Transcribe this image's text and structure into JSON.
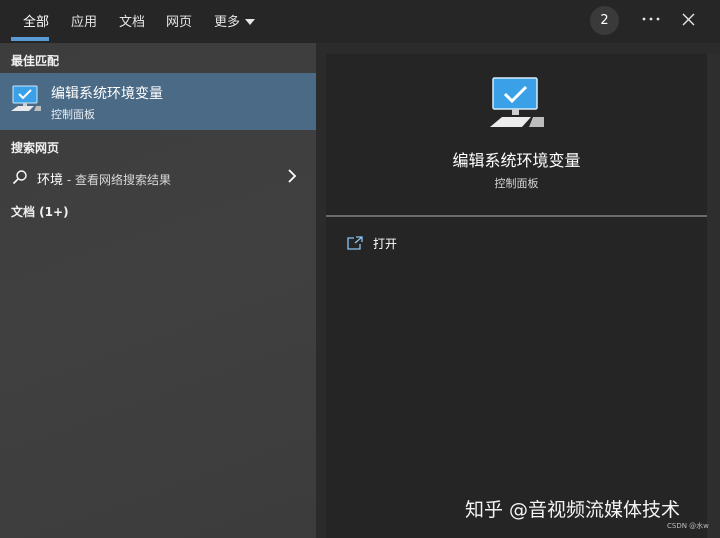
{
  "tabs": [
    {
      "label": "全部",
      "active": true
    },
    {
      "label": "应用"
    },
    {
      "label": "文档"
    },
    {
      "label": "网页"
    },
    {
      "label": "更多"
    }
  ],
  "toolbar": {
    "badge_count": "2",
    "more_icon": "ellipsis-icon",
    "close_icon": "close-icon"
  },
  "left": {
    "best_match_title": "最佳匹配",
    "best_match": {
      "title": "编辑系统环境变量",
      "subtitle": "控制面板",
      "icon": "monitor-check-icon"
    },
    "web_title": "搜索网页",
    "web_item": {
      "term": "环境",
      "hint": " - 查看网络搜索结果",
      "icon": "search-icon"
    },
    "docs_title": "文档 (1+)"
  },
  "preview": {
    "title": "编辑系统环境变量",
    "subtitle": "控制面板",
    "open_label": "打开",
    "open_icon": "open-external-icon"
  },
  "watermark": "知乎 @音视频流媒体技术",
  "csdn_mark": "CSDN @水w",
  "colors": {
    "accent": "#5a9bd4",
    "selected_bg": "#4b6a86",
    "panel_bg": "#252525"
  }
}
